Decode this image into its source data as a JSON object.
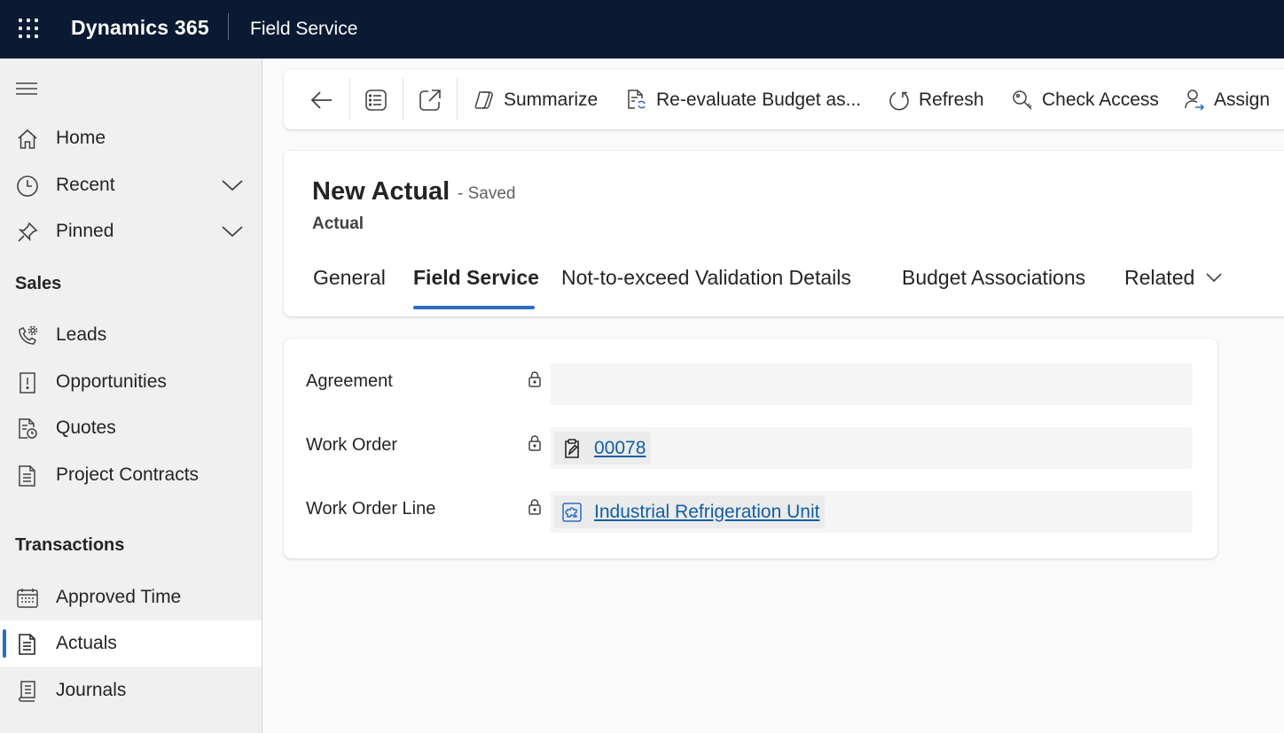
{
  "topbar": {
    "brand": "Dynamics 365",
    "app_name": "Field Service",
    "bg_color": "#0b1a33"
  },
  "sidebar": {
    "items_top": [
      {
        "label": "Home",
        "icon": "home-icon"
      },
      {
        "label": "Recent",
        "icon": "clock-icon",
        "expandable": true
      },
      {
        "label": "Pinned",
        "icon": "pin-icon",
        "expandable": true
      }
    ],
    "section_sales": "Sales",
    "sales_items": [
      {
        "label": "Leads",
        "icon": "phone-gear-icon"
      },
      {
        "label": "Opportunities",
        "icon": "opportunity-icon"
      },
      {
        "label": "Quotes",
        "icon": "quote-icon"
      },
      {
        "label": "Project Contracts",
        "icon": "document-icon"
      }
    ],
    "section_transactions": "Transactions",
    "transaction_items": [
      {
        "label": "Approved Time",
        "icon": "calendar-icon"
      },
      {
        "label": "Actuals",
        "icon": "document-lines-icon",
        "active": true
      },
      {
        "label": "Journals",
        "icon": "journal-icon"
      }
    ],
    "accent_color": "#2d6bc4"
  },
  "commandbar": {
    "summarize": "Summarize",
    "reevaluate": "Re-evaluate Budget as...",
    "refresh": "Refresh",
    "check_access": "Check Access",
    "assign": "Assign"
  },
  "record": {
    "title": "New Actual",
    "status": "- Saved",
    "entity": "Actual",
    "tabs": [
      "General",
      "Field Service",
      "Not-to-exceed Validation Details",
      "Budget Associations",
      "Related"
    ],
    "active_tab": "Field Service"
  },
  "form": {
    "agreement_label": "Agreement",
    "agreement_value": "",
    "work_order_label": "Work Order",
    "work_order_value": "00078",
    "work_order_line_label": "Work Order Line",
    "work_order_line_value": "Industrial Refrigeration Unit",
    "link_color": "#115ea3"
  }
}
